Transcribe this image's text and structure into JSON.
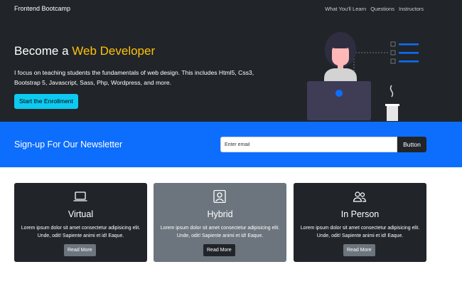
{
  "navbar": {
    "brand": "Frontend Bootcamp",
    "links": [
      "What You'll Learn",
      "Questions",
      "Instructors"
    ]
  },
  "hero": {
    "title_prefix": "Become a ",
    "title_accent": "Web Developer",
    "text": "I focus on teaching students the fundamentals of web design. This includes Html5, Css3, Bootstrap 5, Javascript, Sass, Php, Wordpress, and more.",
    "button_label": "Start the Enrollment",
    "accent_color": "#ffc107"
  },
  "newsletter": {
    "title": "Sign-up For Our Newsletter",
    "email_placeholder": "Enter email",
    "button_label": "Button",
    "background_color": "#0d6efd"
  },
  "cards": [
    {
      "icon": "laptop-icon",
      "title": "Virtual",
      "text": "Lorem ipsum dolor sit amet consectetur adipisicing elit. Unde, odit! Sapiente animi et id! Eaque.",
      "button_label": "Read More"
    },
    {
      "icon": "person-square-icon",
      "title": "Hybrid",
      "text": "Lorem ipsum dolor sit amet consectetur adipisicing elit. Unde, odit! Sapiente animi et id! Eaque.",
      "button_label": "Read More"
    },
    {
      "icon": "people-icon",
      "title": "In Person",
      "text": "Lorem ipsum dolor sit amet consectetur adipisicing elit. Unde, odit! Sapiente animi et id! Eaque.",
      "button_label": "Read More"
    }
  ]
}
